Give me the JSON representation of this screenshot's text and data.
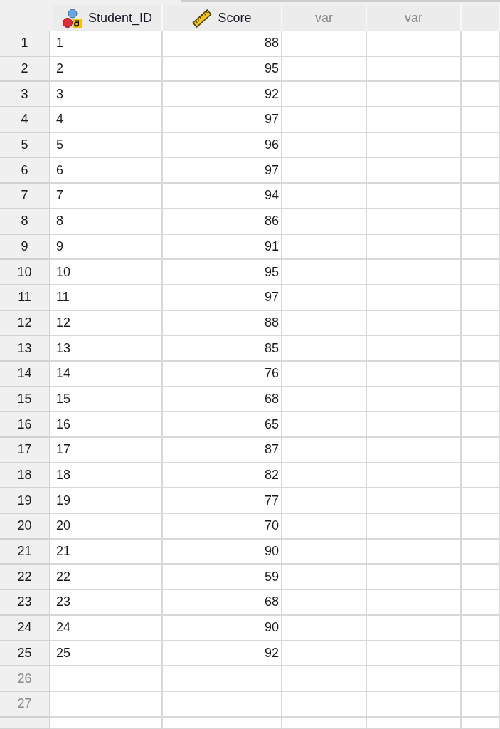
{
  "columns": [
    {
      "label": "Student_ID",
      "kind": "string"
    },
    {
      "label": "Score",
      "kind": "scale"
    },
    {
      "label": "var",
      "kind": "empty"
    },
    {
      "label": "var",
      "kind": "empty"
    },
    {
      "kind": "empty"
    }
  ],
  "rows": [
    {
      "number": "1",
      "empty": false,
      "cells": [
        "1",
        "88"
      ]
    },
    {
      "number": "2",
      "empty": false,
      "cells": [
        "2",
        "95"
      ]
    },
    {
      "number": "3",
      "empty": false,
      "cells": [
        "3",
        "92"
      ]
    },
    {
      "number": "4",
      "empty": false,
      "cells": [
        "4",
        "97"
      ]
    },
    {
      "number": "5",
      "empty": false,
      "cells": [
        "5",
        "96"
      ]
    },
    {
      "number": "6",
      "empty": false,
      "cells": [
        "6",
        "97"
      ]
    },
    {
      "number": "7",
      "empty": false,
      "cells": [
        "7",
        "94"
      ]
    },
    {
      "number": "8",
      "empty": false,
      "cells": [
        "8",
        "86"
      ]
    },
    {
      "number": "9",
      "empty": false,
      "cells": [
        "9",
        "91"
      ]
    },
    {
      "number": "10",
      "empty": false,
      "cells": [
        "10",
        "95"
      ]
    },
    {
      "number": "11",
      "empty": false,
      "cells": [
        "11",
        "97"
      ]
    },
    {
      "number": "12",
      "empty": false,
      "cells": [
        "12",
        "88"
      ]
    },
    {
      "number": "13",
      "empty": false,
      "cells": [
        "13",
        "85"
      ]
    },
    {
      "number": "14",
      "empty": false,
      "cells": [
        "14",
        "76"
      ]
    },
    {
      "number": "15",
      "empty": false,
      "cells": [
        "15",
        "68"
      ]
    },
    {
      "number": "16",
      "empty": false,
      "cells": [
        "16",
        "65"
      ]
    },
    {
      "number": "17",
      "empty": false,
      "cells": [
        "17",
        "87"
      ]
    },
    {
      "number": "18",
      "empty": false,
      "cells": [
        "18",
        "82"
      ]
    },
    {
      "number": "19",
      "empty": false,
      "cells": [
        "19",
        "77"
      ]
    },
    {
      "number": "20",
      "empty": false,
      "cells": [
        "20",
        "70"
      ]
    },
    {
      "number": "21",
      "empty": false,
      "cells": [
        "21",
        "90"
      ]
    },
    {
      "number": "22",
      "empty": false,
      "cells": [
        "22",
        "59"
      ]
    },
    {
      "number": "23",
      "empty": false,
      "cells": [
        "23",
        "68"
      ]
    },
    {
      "number": "24",
      "empty": false,
      "cells": [
        "24",
        "90"
      ]
    },
    {
      "number": "25",
      "empty": false,
      "cells": [
        "25",
        "92"
      ]
    },
    {
      "number": "26",
      "empty": true
    },
    {
      "number": "27",
      "empty": true
    },
    {}
  ]
}
